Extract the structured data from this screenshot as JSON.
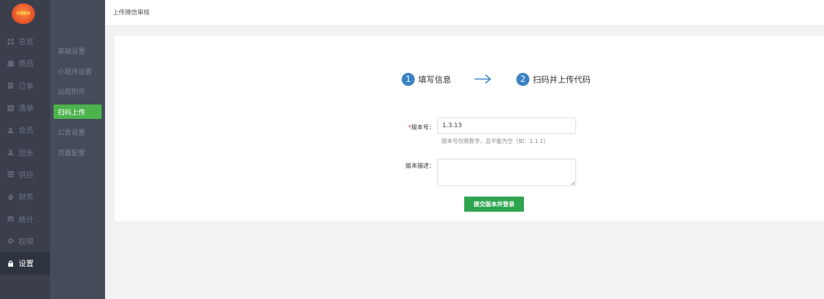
{
  "logo": {
    "text": "乐佳鲜多"
  },
  "main_nav": {
    "items": [
      {
        "label": "总览",
        "icon": "dashboard-icon"
      },
      {
        "label": "商品",
        "icon": "box-icon"
      },
      {
        "label": "订单",
        "icon": "order-icon"
      },
      {
        "label": "清单",
        "icon": "list-icon"
      },
      {
        "label": "会员",
        "icon": "user-icon"
      },
      {
        "label": "团长",
        "icon": "leader-icon"
      },
      {
        "label": "供应",
        "icon": "supply-icon"
      },
      {
        "label": "财务",
        "icon": "money-icon"
      },
      {
        "label": "统计",
        "icon": "chart-icon"
      },
      {
        "label": "权限",
        "icon": "gear-icon"
      },
      {
        "label": "设置",
        "icon": "lock-icon"
      }
    ],
    "active_index": 10
  },
  "sub_nav": {
    "items": [
      {
        "label": "基础设置"
      },
      {
        "label": "小程序设置"
      },
      {
        "label": "远程附件"
      },
      {
        "label": "扫码上传"
      },
      {
        "label": "公告设置"
      },
      {
        "label": "页面配置"
      }
    ],
    "active_index": 3
  },
  "header": {
    "breadcrumb": "上传微信审核"
  },
  "steps": [
    {
      "num": "1",
      "label": "填写信息"
    },
    {
      "num": "2",
      "label": "扫码并上传代码"
    }
  ],
  "form": {
    "version_label": "版本号：",
    "version_required_mark": "*",
    "version_value": "1.3.13",
    "version_hint": "版本号仅限数字，且不能为空（如：1.1.1）",
    "desc_label": "版本描述：",
    "desc_value": "",
    "submit_label": "提交版本并登录"
  },
  "colors": {
    "sidebar_bg": "#3a3f4b",
    "subnav_bg": "#454b58",
    "active_green": "#4cb34d",
    "step_blue": "#3b82c4",
    "button_green": "#2ea44f"
  }
}
